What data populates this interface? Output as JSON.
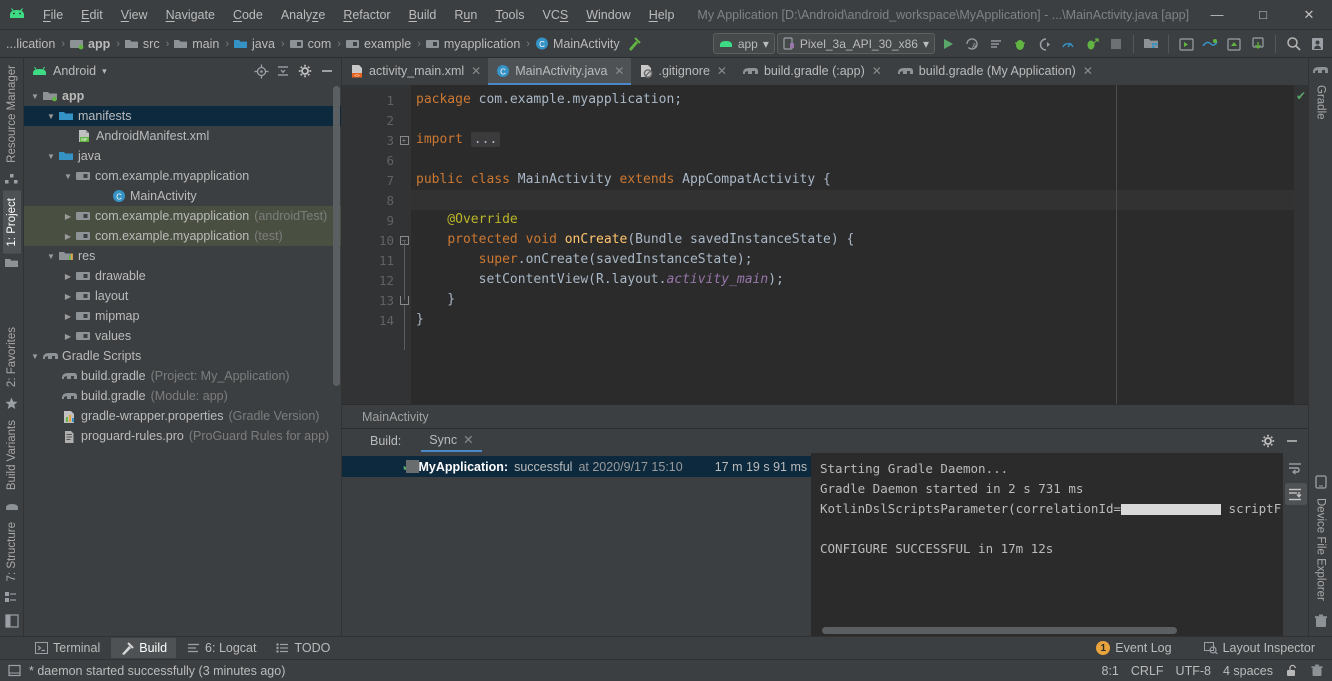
{
  "window": {
    "title": "My Application [D:\\Android\\android_workspace\\MyApplication] - ...\\MainActivity.java [app]",
    "minimize": "—",
    "maximize": "□",
    "close": "✕"
  },
  "menubar": {
    "items": [
      {
        "pre": "",
        "mn": "F",
        "post": "ile"
      },
      {
        "pre": "",
        "mn": "E",
        "post": "dit"
      },
      {
        "pre": "",
        "mn": "V",
        "post": "iew"
      },
      {
        "pre": "",
        "mn": "N",
        "post": "avigate"
      },
      {
        "pre": "",
        "mn": "C",
        "post": "ode"
      },
      {
        "pre": "Analy",
        "mn": "z",
        "post": "e"
      },
      {
        "pre": "",
        "mn": "R",
        "post": "efactor"
      },
      {
        "pre": "",
        "mn": "B",
        "post": "uild"
      },
      {
        "pre": "R",
        "mn": "u",
        "post": "n"
      },
      {
        "pre": "",
        "mn": "T",
        "post": "ools"
      },
      {
        "pre": "VC",
        "mn": "S",
        "post": ""
      },
      {
        "pre": "",
        "mn": "W",
        "post": "indow"
      },
      {
        "pre": "",
        "mn": "H",
        "post": "elp"
      }
    ]
  },
  "navbar": {
    "crumbs": [
      {
        "label": "...lication",
        "icon": "none",
        "bold": false
      },
      {
        "label": "app",
        "icon": "module",
        "bold": true
      },
      {
        "label": "src",
        "icon": "folder-grey",
        "bold": false
      },
      {
        "label": "main",
        "icon": "folder-grey",
        "bold": false
      },
      {
        "label": "java",
        "icon": "folder-blue",
        "bold": false
      },
      {
        "label": "com",
        "icon": "package",
        "bold": false
      },
      {
        "label": "example",
        "icon": "package",
        "bold": false
      },
      {
        "label": "myapplication",
        "icon": "package",
        "bold": false
      },
      {
        "label": "MainActivity",
        "icon": "class",
        "bold": false
      }
    ],
    "separator": "›",
    "run_config": "app",
    "device": "Pixel_3a_API_30_x86",
    "dropdown_arrow": "▾",
    "actions": [
      {
        "name": "run-button"
      },
      {
        "name": "apply-changes-icon"
      },
      {
        "name": "apply-code-changes-icon"
      },
      {
        "name": "debug-button"
      },
      {
        "name": "run-with-coverage-icon"
      },
      {
        "name": "profiler-icon"
      },
      {
        "name": "attach-debugger-icon"
      },
      {
        "name": "stop-button"
      },
      {
        "name": "avd-manager-icon"
      },
      {
        "name": "sdk-manager-icon"
      },
      {
        "name": "sync-gradle-icon"
      },
      {
        "name": "project-structure-icon"
      },
      {
        "name": "device-file-icon"
      },
      {
        "name": "search-icon"
      },
      {
        "name": "account-icon"
      }
    ]
  },
  "left_strip": {
    "top": [
      {
        "label": "Resource Manager",
        "icon": "resource-icon",
        "active": false
      },
      {
        "label": "1: Project",
        "icon": "folder-icon",
        "active": true
      }
    ],
    "bottom": [
      {
        "label": "2: Favorites",
        "icon": "star-icon",
        "active": false
      },
      {
        "label": "Build Variants",
        "icon": "variants-icon",
        "active": false
      },
      {
        "label": "7: Structure",
        "icon": "structure-icon",
        "active": false
      }
    ]
  },
  "right_strip": {
    "top": [
      {
        "label": "Gradle",
        "icon": "gradle-elephant-icon"
      }
    ],
    "bottom": [
      {
        "label": "Device File Explorer",
        "icon": "device-icon"
      }
    ]
  },
  "project_panel": {
    "title": "Android",
    "dropdown_arrow": "▾",
    "actions": [
      {
        "name": "locate-file-icon"
      },
      {
        "name": "collapse-all-icon"
      },
      {
        "name": "settings-gear-icon"
      },
      {
        "name": "hide-panel-icon"
      }
    ],
    "tree": [
      {
        "indent": 0,
        "twist": "▼",
        "icon": "module-app",
        "label": "app",
        "bold": true,
        "sub": "",
        "state": "normal"
      },
      {
        "indent": 1,
        "twist": "▼",
        "icon": "folder-blue",
        "label": "manifests",
        "bold": false,
        "sub": "",
        "state": "selected"
      },
      {
        "indent": 2,
        "twist": "",
        "icon": "manifest-xml",
        "label": "AndroidManifest.xml",
        "bold": false,
        "sub": "",
        "state": "normal"
      },
      {
        "indent": 1,
        "twist": "▼",
        "icon": "folder-blue",
        "label": "java",
        "bold": false,
        "sub": "",
        "state": "normal"
      },
      {
        "indent": 2,
        "twist": "▼",
        "icon": "package",
        "label": "com.example.myapplication",
        "bold": false,
        "sub": "",
        "state": "normal"
      },
      {
        "indent": 3,
        "twist": "",
        "icon": "class",
        "label": "MainActivity",
        "bold": false,
        "sub": "",
        "state": "normal"
      },
      {
        "indent": 2,
        "twist": "▶",
        "icon": "package",
        "label": "com.example.myapplication",
        "bold": false,
        "sub": "(androidTest)",
        "state": "test"
      },
      {
        "indent": 2,
        "twist": "▶",
        "icon": "package",
        "label": "com.example.myapplication",
        "bold": false,
        "sub": "(test)",
        "state": "test"
      },
      {
        "indent": 1,
        "twist": "▼",
        "icon": "folder-res",
        "label": "res",
        "bold": false,
        "sub": "",
        "state": "normal"
      },
      {
        "indent": 2,
        "twist": "▶",
        "icon": "folder-grey",
        "label": "drawable",
        "bold": false,
        "sub": "",
        "state": "normal"
      },
      {
        "indent": 2,
        "twist": "▶",
        "icon": "folder-grey",
        "label": "layout",
        "bold": false,
        "sub": "",
        "state": "normal"
      },
      {
        "indent": 2,
        "twist": "▶",
        "icon": "folder-grey",
        "label": "mipmap",
        "bold": false,
        "sub": "",
        "state": "normal"
      },
      {
        "indent": 2,
        "twist": "▶",
        "icon": "folder-grey",
        "label": "values",
        "bold": false,
        "sub": "",
        "state": "normal"
      },
      {
        "indent": 0,
        "twist": "▼",
        "icon": "gradle-elephant",
        "label": "Gradle Scripts",
        "bold": false,
        "sub": "",
        "state": "normal"
      },
      {
        "indent": 1,
        "twist": "",
        "icon": "gradle-elephant",
        "label": "build.gradle",
        "bold": false,
        "sub": "(Project: My_Application)",
        "state": "normal"
      },
      {
        "indent": 1,
        "twist": "",
        "icon": "gradle-elephant",
        "label": "build.gradle",
        "bold": false,
        "sub": "(Module: app)",
        "state": "normal"
      },
      {
        "indent": 1,
        "twist": "",
        "icon": "properties",
        "label": "gradle-wrapper.properties",
        "bold": false,
        "sub": "(Gradle Version)",
        "state": "normal"
      },
      {
        "indent": 1,
        "twist": "",
        "icon": "proguard",
        "label": "proguard-rules.pro",
        "bold": false,
        "sub": "(ProGuard Rules for app)",
        "state": "normal"
      }
    ]
  },
  "editor": {
    "tabs": [
      {
        "label": "activity_main.xml",
        "icon": "layout-xml-icon",
        "active": false,
        "close": "✕"
      },
      {
        "label": "MainActivity.java",
        "icon": "class-icon",
        "active": true,
        "close": "✕"
      },
      {
        "label": ".gitignore",
        "icon": "gitignore-icon",
        "active": false,
        "close": "✕"
      },
      {
        "label": "build.gradle (:app)",
        "icon": "gradle-icon",
        "active": false,
        "close": "✕"
      },
      {
        "label": "build.gradle (My Application)",
        "icon": "gradle-icon",
        "active": false,
        "close": "✕"
      }
    ],
    "breadcrumb": "MainActivity",
    "line_numbers": [
      "1",
      "2",
      "3",
      "6",
      "7",
      "8",
      "9",
      "10",
      "11",
      "12",
      "13",
      "14"
    ],
    "code_lines": [
      {
        "n": "1",
        "tokens": [
          {
            "t": "package ",
            "c": "k"
          },
          {
            "t": "com.example.myapplication;",
            "c": "s"
          }
        ]
      },
      {
        "n": "2",
        "tokens": []
      },
      {
        "n": "3",
        "tokens": [
          {
            "t": "import ",
            "c": "k"
          },
          {
            "t": "...",
            "c": "fold"
          }
        ]
      },
      {
        "n": "6",
        "tokens": []
      },
      {
        "n": "7",
        "tokens": [
          {
            "t": "public ",
            "c": "k"
          },
          {
            "t": "class ",
            "c": "k"
          },
          {
            "t": "MainActivity ",
            "c": "s"
          },
          {
            "t": "extends ",
            "c": "k"
          },
          {
            "t": "AppCompatActivity {",
            "c": "s"
          }
        ]
      },
      {
        "n": "8",
        "tokens": []
      },
      {
        "n": "9",
        "tokens": [
          {
            "t": "    @Override",
            "c": "an"
          }
        ]
      },
      {
        "n": "10",
        "tokens": [
          {
            "t": "    ",
            "c": "s"
          },
          {
            "t": "protected ",
            "c": "k"
          },
          {
            "t": "void ",
            "c": "k"
          },
          {
            "t": "onCreate",
            "c": "fn"
          },
          {
            "t": "(Bundle savedInstanceState) {",
            "c": "s"
          }
        ]
      },
      {
        "n": "11",
        "tokens": [
          {
            "t": "        ",
            "c": "s"
          },
          {
            "t": "super",
            "c": "k"
          },
          {
            "t": ".onCreate(savedInstanceState);",
            "c": "s"
          }
        ]
      },
      {
        "n": "12",
        "tokens": [
          {
            "t": "        setContentView(R.layout.",
            "c": "s"
          },
          {
            "t": "activity_main",
            "c": "it"
          },
          {
            "t": ");",
            "c": "s"
          }
        ]
      },
      {
        "n": "13",
        "tokens": [
          {
            "t": "    }",
            "c": "s"
          }
        ]
      },
      {
        "n": "14",
        "tokens": [
          {
            "t": "}",
            "c": "s"
          }
        ]
      }
    ]
  },
  "build_panel": {
    "label": "Build:",
    "tab": "Sync",
    "tab_close": "✕",
    "result": {
      "check": "✔",
      "name": "MyApplication:",
      "status": "successful",
      "at": "at 2020/9/17 15:10",
      "duration": "17 m 19 s 91 ms"
    },
    "console": [
      "Starting Gradle Daemon...",
      "Gradle Daemon started in 2 s 731 ms",
      "KOTLIN_REDACTED",
      "",
      "CONFIGURE SUCCESSFUL in 17m 12s"
    ],
    "console_kotlin_prefix": "KotlinDslScriptsParameter(correlationId=",
    "console_kotlin_suffix": " scriptFiles=[]) => StandardKotlinDslScriptsModel(scripts=[]",
    "actions": [
      {
        "name": "settings-gear-icon"
      },
      {
        "name": "hide-panel-icon"
      },
      {
        "name": "soft-wrap-icon"
      },
      {
        "name": "scroll-to-end-icon"
      }
    ]
  },
  "toolwindow_bar": {
    "items": [
      {
        "label": "Terminal",
        "icon": "terminal-icon",
        "active": false
      },
      {
        "label": "Build",
        "icon": "build-hammer-icon",
        "active": true
      },
      {
        "label": "6: Logcat",
        "icon": "logcat-icon",
        "active": false
      },
      {
        "label": "TODO",
        "icon": "todo-icon",
        "active": false
      }
    ],
    "right": [
      {
        "label": "Event Log",
        "icon": "event-log-icon",
        "badge": "1"
      },
      {
        "label": "Layout Inspector",
        "icon": "layout-inspector-icon",
        "badge": ""
      }
    ]
  },
  "statusbar": {
    "icon": "memory-icon",
    "message": "* daemon started successfully (3 minutes ago)",
    "caret": "8:1",
    "line_separator": "CRLF",
    "encoding": "UTF-8",
    "indent": "4 spaces",
    "lock_icon": "unlocked-icon",
    "trash_icon": "trash-icon"
  },
  "colors": {
    "chrome": "#3c3f41",
    "editor_bg": "#2b2b2b",
    "gutter_bg": "#313335",
    "selection_blue": "#0d293e",
    "test_green": "#4a5041",
    "accent_blue": "#4a88c7",
    "keyword_orange": "#cc7832",
    "method_yellow": "#ffc66d",
    "annotation_yellow": "#bbb529",
    "field_purple": "#9876aa",
    "text": "#a9b7c6",
    "success_green": "#59a869",
    "badge_orange": "#e8a33d"
  }
}
